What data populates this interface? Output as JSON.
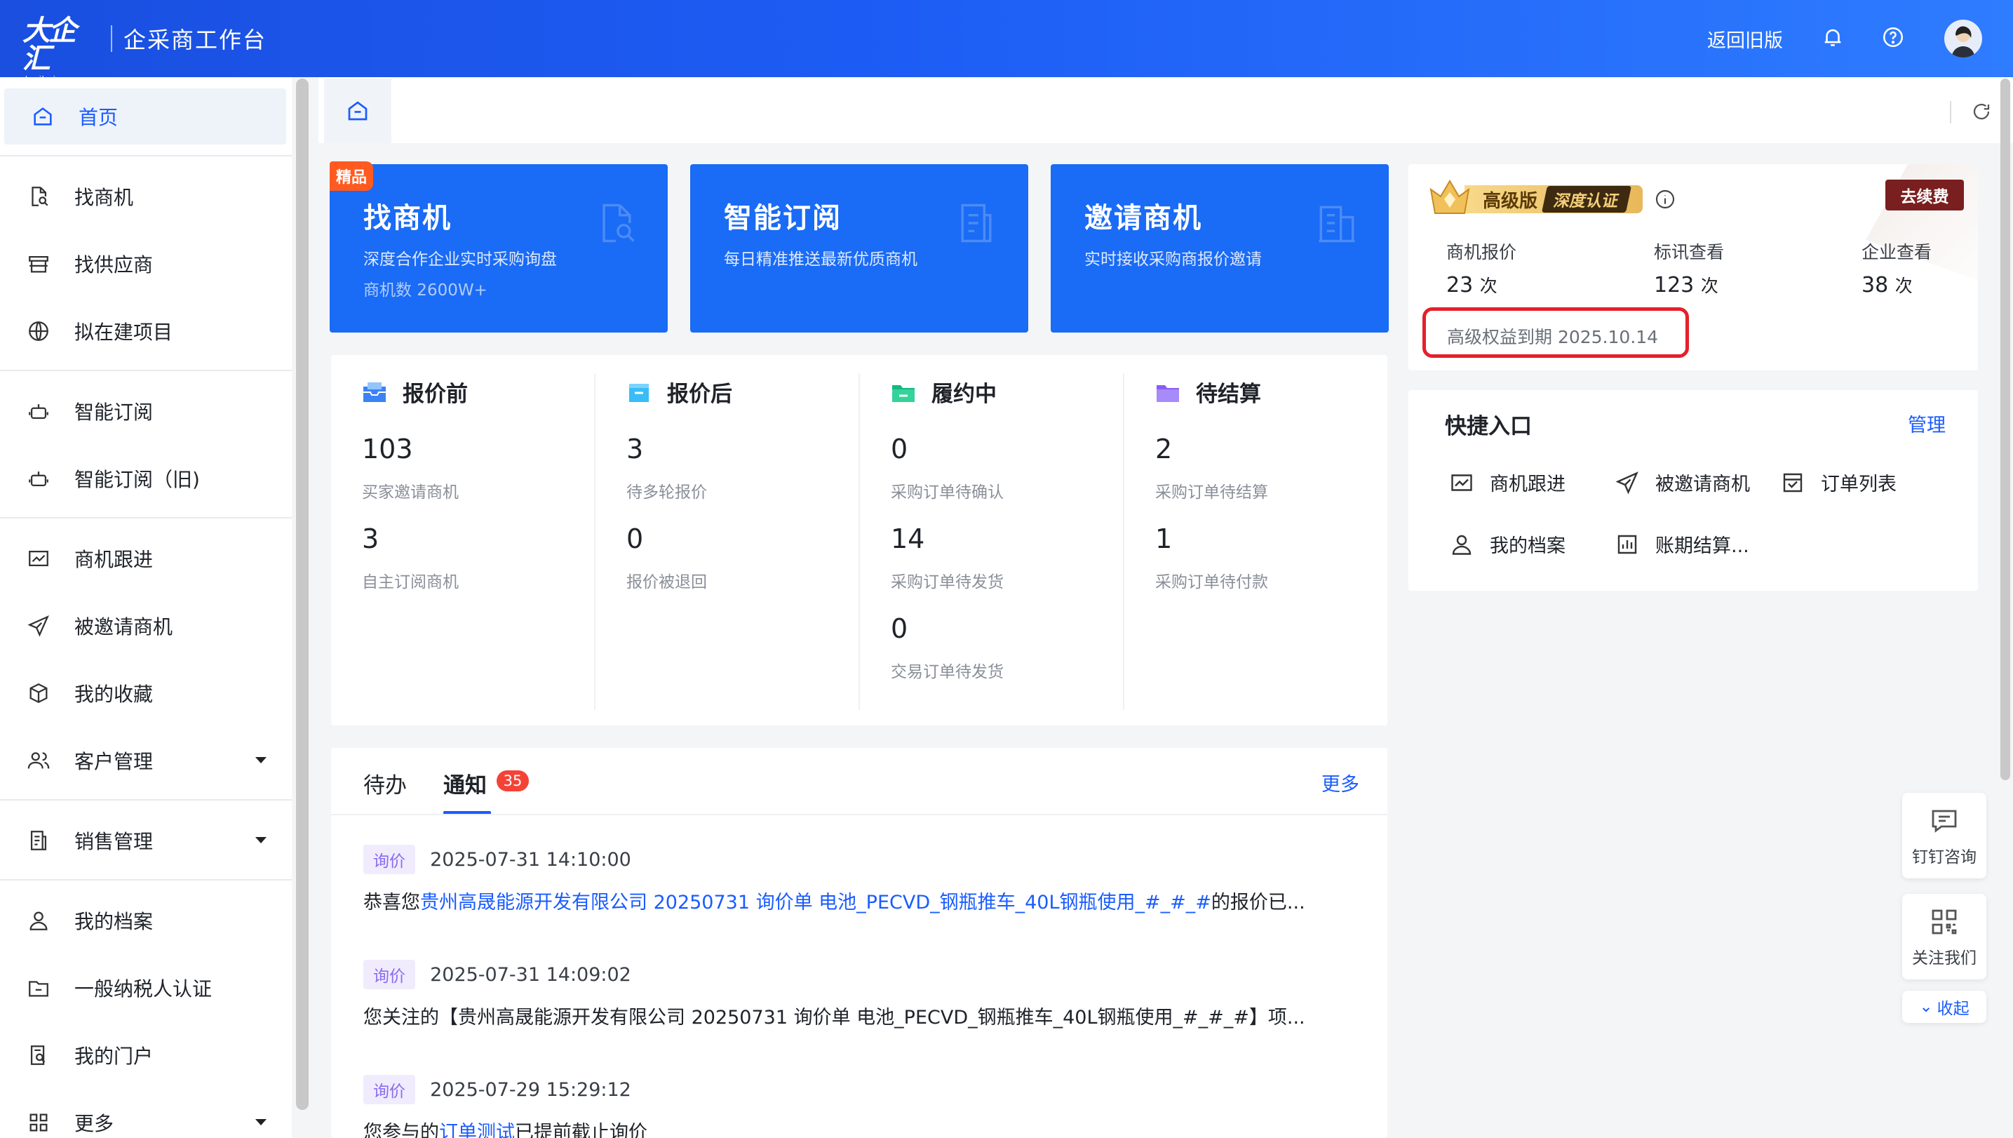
{
  "header": {
    "logo_text": "大企汇",
    "logo_domain": "daqihui.com",
    "title": "企采商工作台",
    "old_version": "返回旧版",
    "icons": [
      "bell-icon",
      "help-icon",
      "avatar"
    ]
  },
  "sidebar": {
    "items": [
      {
        "label": "首页",
        "icon": "home-icon",
        "active": true
      },
      {
        "label": "找商机",
        "icon": "doc-search-icon"
      },
      {
        "label": "找供应商",
        "icon": "store-icon"
      },
      {
        "label": "拟在建项目",
        "icon": "globe-icon"
      },
      {
        "label": "智能订阅",
        "icon": "robot-icon"
      },
      {
        "label": "智能订阅（旧)",
        "icon": "robot-icon"
      },
      {
        "label": "商机跟进",
        "icon": "chart-icon"
      },
      {
        "label": "被邀请商机",
        "icon": "send-icon"
      },
      {
        "label": "我的收藏",
        "icon": "cube-icon"
      },
      {
        "label": "客户管理",
        "icon": "users-icon",
        "expandable": true
      },
      {
        "label": "销售管理",
        "icon": "sales-icon",
        "expandable": true
      },
      {
        "label": "我的档案",
        "icon": "user-icon"
      },
      {
        "label": "一般纳税人认证",
        "icon": "folder-icon"
      },
      {
        "label": "我的门户",
        "icon": "portal-icon"
      },
      {
        "label": "更多",
        "icon": "grid-icon",
        "expandable": true
      }
    ]
  },
  "feature_cards": [
    {
      "title": "找商机",
      "desc": "深度合作企业实时采购询盘",
      "count": "商机数 2600W+",
      "badge": "精品"
    },
    {
      "title": "智能订阅",
      "desc": "每日精准推送最新优质商机"
    },
    {
      "title": "邀请商机",
      "desc": "实时接收采购商报价邀请"
    }
  ],
  "stats": [
    {
      "title": "报价前",
      "rows": [
        {
          "value": "103",
          "label": "买家邀请商机"
        },
        {
          "value": "3",
          "label": "自主订阅商机"
        }
      ]
    },
    {
      "title": "报价后",
      "rows": [
        {
          "value": "3",
          "label": "待多轮报价"
        },
        {
          "value": "0",
          "label": "报价被退回"
        }
      ]
    },
    {
      "title": "履约中",
      "rows": [
        {
          "value": "0",
          "label": "采购订单待确认"
        },
        {
          "value": "14",
          "label": "采购订单待发货"
        },
        {
          "value": "0",
          "label": "交易订单待发货"
        }
      ]
    },
    {
      "title": "待结算",
      "rows": [
        {
          "value": "2",
          "label": "采购订单待结算"
        },
        {
          "value": "1",
          "label": "采购订单待付款"
        }
      ]
    }
  ],
  "notices": {
    "tabs": [
      "待办",
      "通知"
    ],
    "count": "35",
    "more": "更多",
    "items": [
      {
        "tag": "询价",
        "time": "2025-07-31 14:10:00",
        "pre": "恭喜您",
        "link": "贵州高晟能源开发有限公司 20250731 询价单 电池_PECVD_钢瓶推车_40L钢瓶使用_#_#_#",
        "post": "的报价已..."
      },
      {
        "tag": "询价",
        "time": "2025-07-31 14:09:02",
        "pre": "您关注的【贵州高晟能源开发有限公司 20250731 询价单 电池_PECVD_钢瓶推车_40L钢瓶使用_#_#_#】项...",
        "link": "",
        "post": ""
      },
      {
        "tag": "询价",
        "time": "2025-07-29 15:29:12",
        "pre": "您参与的",
        "link": "订单测试",
        "post": "已提前截止询价"
      }
    ]
  },
  "membership": {
    "level": "高级版",
    "auth": "深度认证",
    "renew": "去续费",
    "stats": [
      {
        "label": "商机报价",
        "value": "23",
        "unit": "次"
      },
      {
        "label": "标讯查看",
        "value": "123",
        "unit": "次"
      },
      {
        "label": "企业查看",
        "value": "38",
        "unit": "次"
      }
    ],
    "expiry": "高级权益到期 2025.10.14"
  },
  "quick_entry": {
    "title": "快捷入口",
    "manage": "管理",
    "items": [
      {
        "label": "商机跟进",
        "icon": "chart-icon"
      },
      {
        "label": "被邀请商机",
        "icon": "send-icon"
      },
      {
        "label": "订单列表",
        "icon": "order-icon"
      },
      {
        "label": "我的档案",
        "icon": "user-icon"
      },
      {
        "label": "账期结算...",
        "icon": "bar-chart-icon"
      }
    ]
  },
  "float_tools": {
    "dingtalk": "钉钉咨询",
    "follow": "关注我们",
    "collapse": "收起"
  },
  "colors": {
    "primary": "#1a5cff",
    "header": "#1d5df5",
    "card": "#1a6bf5",
    "alert": "#e5202b"
  }
}
